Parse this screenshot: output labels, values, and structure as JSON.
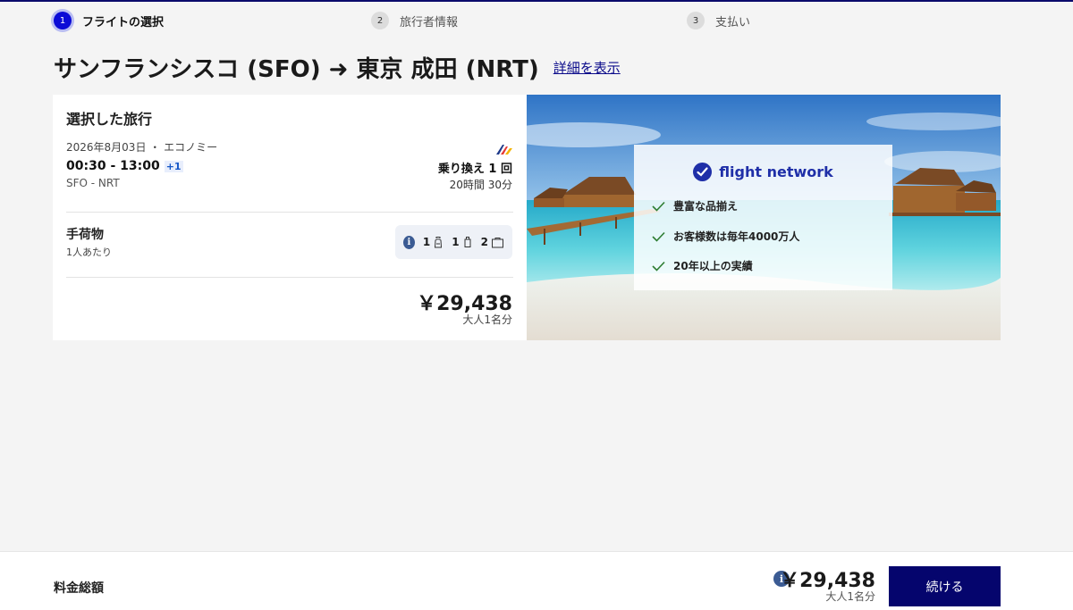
{
  "steps": [
    {
      "num": "1",
      "label": "フライトの選択"
    },
    {
      "num": "2",
      "label": "旅行者情報"
    },
    {
      "num": "3",
      "label": "支払い"
    }
  ],
  "header": {
    "title": "サンフランシスコ (SFO) ➜ 東京 成田 (NRT)",
    "details_link": "詳細を表示"
  },
  "trip": {
    "card_title": "選択した旅行",
    "date": "2026年8月03日 ・ エコノミー",
    "time": "00:30 - 13:00",
    "plus_day": "+1",
    "route": "SFO - NRT",
    "stops": "乗り換え 1 回",
    "duration": "20時間 30分"
  },
  "baggage": {
    "title": "手荷物",
    "subtitle": "1人あたり",
    "personal_count": "1",
    "carry_on_count": "1",
    "checked_count": "2"
  },
  "price": {
    "amount": "￥29,438",
    "per": "大人1名分"
  },
  "promo": {
    "brand": "flight network",
    "features": [
      "豊富な品揃え",
      "お客様数は毎年4000万人",
      "20年以上の実績"
    ]
  },
  "footer": {
    "total_label": "料金総額",
    "amount": "￥29,438",
    "per": "大人1名分",
    "continue_label": "続ける"
  },
  "colors": {
    "accent": "#05056d",
    "active_step": "#0b0bd6",
    "link": "#0a0a8a",
    "check": "#2e7d32"
  }
}
